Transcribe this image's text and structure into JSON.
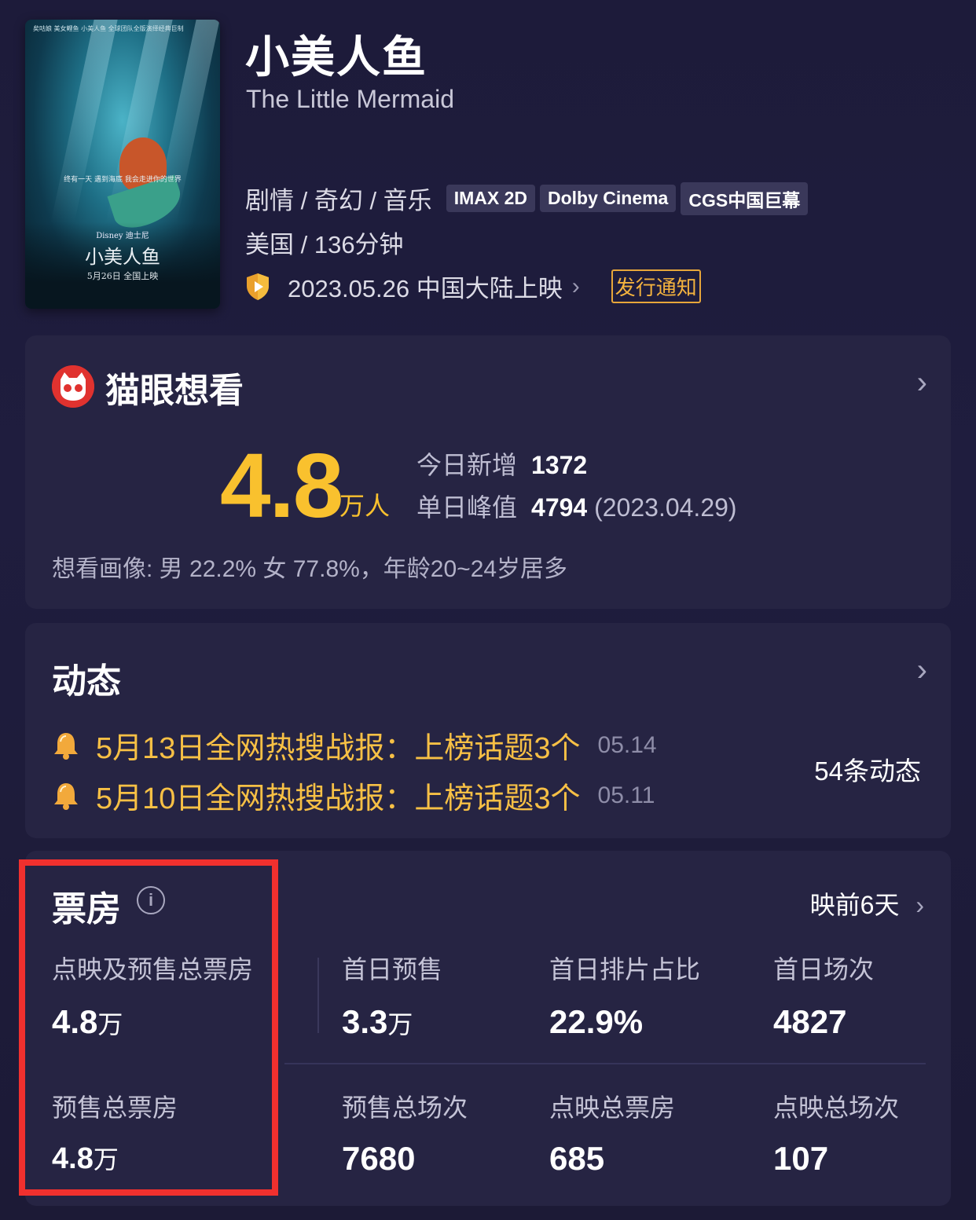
{
  "poster": {
    "top_text": "矣咕娘 美女鲤鱼 小美人鱼 全球团队全版演绎经典巨制",
    "tagline": "终有一天 遇到海底 我会走进你的世界",
    "brand": "Disney 迪士尼",
    "title": "小美人鱼",
    "date_text": "5月26日 全国上映"
  },
  "movie": {
    "title_cn": "小美人鱼",
    "title_en": "The Little Mermaid",
    "genres": "剧情 / 奇幻 / 音乐",
    "tags": [
      "IMAX 2D",
      "Dolby Cinema",
      "CGS中国巨幕"
    ],
    "region_duration": "美国 / 136分钟",
    "release": "2023.05.26 中国大陆上映",
    "release_notice": "发行通知"
  },
  "want": {
    "title": "猫眼想看",
    "number": "4.8",
    "unit": "万人",
    "today_label": "今日新增",
    "today_value": "1372",
    "peak_label": "单日峰值",
    "peak_value": "4794",
    "peak_date": "(2023.04.29)",
    "portrait": "想看画像: 男 22.2%  女 77.8%，年龄20~24岁居多"
  },
  "news": {
    "title": "动态",
    "items": [
      {
        "text": "5月13日全网热搜战报：上榜话题3个",
        "date": "05.14"
      },
      {
        "text": "5月10日全网热搜战报：上榜话题3个",
        "date": "05.11"
      }
    ],
    "count": "54条动态"
  },
  "boxoffice": {
    "title": "票房",
    "info_glyph": "i",
    "pre_days": "映前6天",
    "cells": [
      {
        "label": "点映及预售总票房",
        "value": "4.8",
        "unit": "万"
      },
      {
        "label": "首日预售",
        "value": "3.3",
        "unit": "万"
      },
      {
        "label": "首日排片占比",
        "value": "22.9%",
        "unit": ""
      },
      {
        "label": "首日场次",
        "value": "4827",
        "unit": ""
      },
      {
        "label": "预售总票房",
        "value": "4.8",
        "unit": "万"
      },
      {
        "label": "预售总场次",
        "value": "7680",
        "unit": ""
      },
      {
        "label": "点映总票房",
        "value": "685",
        "unit": ""
      },
      {
        "label": "点映总场次",
        "value": "107",
        "unit": ""
      }
    ]
  },
  "colors": {
    "accent": "#f9c12e",
    "highlight_box": "#f0302e",
    "background": "#1d1b3a",
    "card": "#262443"
  },
  "icons": [
    "shield-play-icon",
    "cat-logo-icon",
    "chevron-right-icon",
    "bell-icon",
    "info-icon"
  ]
}
